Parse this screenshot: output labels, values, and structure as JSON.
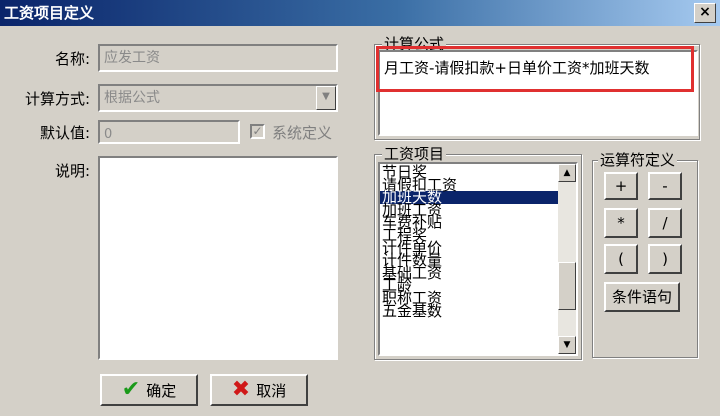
{
  "window": {
    "title": "工资项目定义",
    "close_glyph": "×"
  },
  "form": {
    "name_label": "名称:",
    "name_value": "应发工资",
    "calc_label": "计算方式:",
    "calc_value": "根据公式",
    "default_label": "默认值:",
    "default_value": "0",
    "system_label": "系统定义",
    "desc_label": "说明:"
  },
  "formula": {
    "group_title": "计算公式",
    "text": "月工资-请假扣款+日单价工资*加班天数"
  },
  "items": {
    "group_title": "工资项目",
    "list": [
      "节日奖",
      "请假扣工资",
      "加班天数",
      "加班工资",
      "车费补贴",
      "工程奖",
      "计件单价",
      "计件数量",
      "基础工资",
      "工龄",
      "职称工资",
      "五金基数"
    ],
    "selected": "加班天数"
  },
  "operators": {
    "group_title": "运算符定义",
    "plus": "+",
    "minus": "-",
    "multiply": "*",
    "divide": "/",
    "lparen": "(",
    "rparen": ")",
    "condition": "条件语句"
  },
  "buttons": {
    "ok": "确定",
    "cancel": "取消"
  },
  "icons": {
    "dropdown": "chevron-down-icon",
    "ok": "check-icon",
    "cancel": "x-icon"
  },
  "colors": {
    "title_bar": "#0a246a",
    "selection": "#0a246a",
    "highlight": "#e03030"
  }
}
